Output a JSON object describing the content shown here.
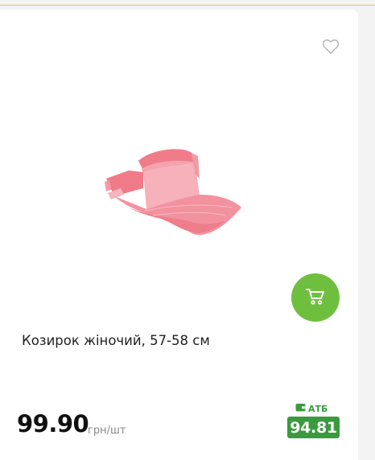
{
  "product": {
    "name": "Козирок жіночий, 57-58 см",
    "price": "99.90",
    "unit": "грн/шт",
    "loyalty_label": "АТБ",
    "loyalty_price": "94.81"
  },
  "icons": {
    "favorite": "heart-outline-icon",
    "cart": "cart-icon",
    "wallet": "wallet-icon"
  },
  "colors": {
    "accent": "#6fbf3f",
    "loyalty": "#3a9b3e",
    "top_line": "#f1c840"
  }
}
